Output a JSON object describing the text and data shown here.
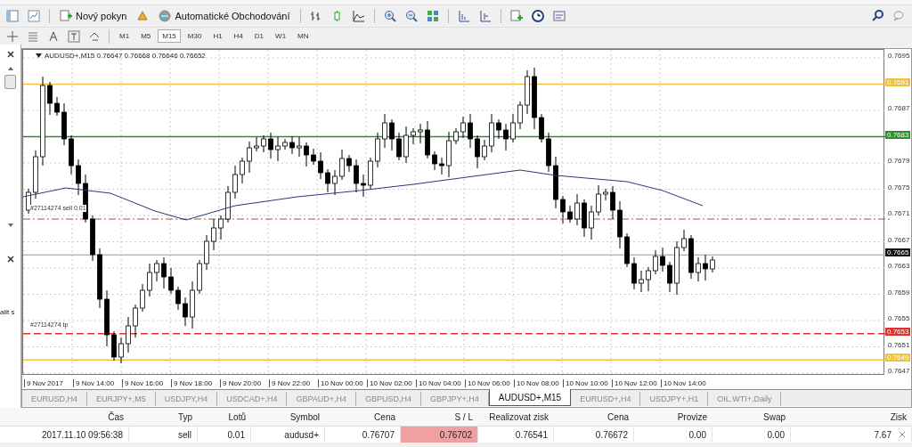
{
  "toolbar": {
    "buttons": [
      {
        "label": "Nový pokyn"
      },
      {
        "label": "Automatické Obchodování"
      }
    ]
  },
  "timeframes": [
    {
      "label": "M1",
      "selected": false
    },
    {
      "label": "M5",
      "selected": false
    },
    {
      "label": "M15",
      "selected": true
    },
    {
      "label": "M30",
      "selected": false
    },
    {
      "label": "H1",
      "selected": false
    },
    {
      "label": "H4",
      "selected": false
    },
    {
      "label": "D1",
      "selected": false
    },
    {
      "label": "W1",
      "selected": false
    },
    {
      "label": "MN",
      "selected": false
    }
  ],
  "side_panel": {
    "text": "alit s"
  },
  "chart": {
    "header": "AUDUSD+,M15  0.76647 0.76668 0.76646 0.76652",
    "order_labels": [
      "#27114274 sell 0.01",
      "#27114274 tp"
    ],
    "price_ticks": [
      "0.7695",
      "0.7687",
      "0.7679",
      "0.7675",
      "0.7671",
      "0.7667",
      "0.7663",
      "0.7659",
      "0.7655",
      "0.7651",
      "0.7647"
    ],
    "price_markers": [
      {
        "text": "0.7691",
        "kind": "level",
        "color": "#f0c040"
      },
      {
        "text": "0.7683",
        "kind": "level",
        "color": "#2e8b2e"
      },
      {
        "text": "0.7665",
        "kind": "price",
        "color": "#111111"
      },
      {
        "text": "0.7653",
        "kind": "take_profit",
        "color": "#e03030"
      },
      {
        "text": "0.7649",
        "kind": "level",
        "color": "#f0c040"
      }
    ],
    "time_labels": [
      "9 Nov 2017",
      "9 Nov 14:00",
      "9 Nov 16:00",
      "9 Nov 18:00",
      "9 Nov 20:00",
      "9 Nov 22:00",
      "10 Nov 00:00",
      "10 Nov 02:00",
      "10 Nov 04:00",
      "10 Nov 06:00",
      "10 Nov 08:00",
      "10 Nov 10:00",
      "10 Nov 12:00",
      "10 Nov 14:00"
    ]
  },
  "tabs": [
    {
      "label": "EURUSD,H4",
      "selected": false
    },
    {
      "label": "EURJPY+,M5",
      "selected": false
    },
    {
      "label": "USDJPY,H4",
      "selected": false
    },
    {
      "label": "USDCAD+,H4",
      "selected": false
    },
    {
      "label": "GBPAUD+,H4",
      "selected": false
    },
    {
      "label": "GBPUSD,H4",
      "selected": false
    },
    {
      "label": "GBPJPY+,H4",
      "selected": false
    },
    {
      "label": "AUDUSD+,M15",
      "selected": true
    },
    {
      "label": "EURUSD+,H4",
      "selected": false
    },
    {
      "label": "USDJPY+,H1",
      "selected": false
    },
    {
      "label": "OIL.WTI+,Daily",
      "selected": false
    }
  ],
  "table": {
    "columns": [
      "Čas",
      "Typ",
      "Lotů",
      "Symbol",
      "Cena",
      "S / L",
      "Realizovat zisk",
      "Cena",
      "Provize",
      "Swap",
      "Zisk"
    ],
    "rows": [
      {
        "cells": [
          {
            "text": "2017.11.10 09:56:38",
            "highlighted": false
          },
          {
            "text": "sell",
            "highlighted": false
          },
          {
            "text": "0.01",
            "highlighted": false
          },
          {
            "text": "audusd+",
            "highlighted": false
          },
          {
            "text": "0.76707",
            "highlighted": false
          },
          {
            "text": "0.76702",
            "highlighted": true
          },
          {
            "text": "0.76541",
            "highlighted": false
          },
          {
            "text": "0.76672",
            "highlighted": false
          },
          {
            "text": "0.00",
            "highlighted": false
          },
          {
            "text": "0.00",
            "highlighted": false
          },
          {
            "text": "7.67",
            "highlighted": false
          }
        ]
      }
    ]
  }
}
